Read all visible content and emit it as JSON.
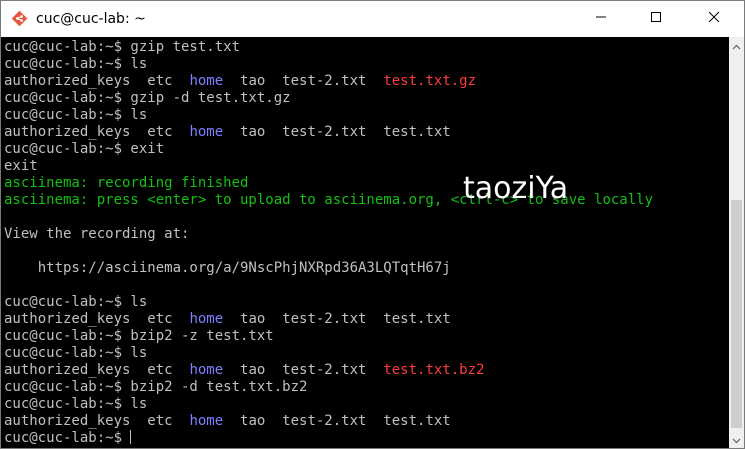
{
  "window": {
    "title": "cuc@cuc-lab: ~"
  },
  "icons": {
    "app": "git-diamond-icon",
    "minimize": "minimize-icon",
    "maximize": "maximize-icon",
    "close": "close-icon",
    "scroll_up": "chevron-up-icon",
    "scroll_down": "chevron-down-icon"
  },
  "colors": {
    "background": "#000000",
    "text": "#c0c0c0",
    "directory": "#7f7fff",
    "archive": "#ff3b3b",
    "asciinema": "#13c013",
    "watermark": "#ffffff"
  },
  "terminal": {
    "lines": [
      [
        {
          "text": "cuc@cuc-lab:~$ gzip test.txt",
          "color": "default"
        }
      ],
      [
        {
          "text": "cuc@cuc-lab:~$ ls",
          "color": "default"
        }
      ],
      [
        {
          "text": "authorized_keys  etc  ",
          "color": "default"
        },
        {
          "text": "home",
          "color": "blue"
        },
        {
          "text": "  tao  test-2.txt  ",
          "color": "default"
        },
        {
          "text": "test.txt.gz",
          "color": "red"
        }
      ],
      [
        {
          "text": "cuc@cuc-lab:~$ gzip -d test.txt.gz",
          "color": "default"
        }
      ],
      [
        {
          "text": "cuc@cuc-lab:~$ ls",
          "color": "default"
        }
      ],
      [
        {
          "text": "authorized_keys  etc  ",
          "color": "default"
        },
        {
          "text": "home",
          "color": "blue"
        },
        {
          "text": "  tao  test-2.txt  test.txt",
          "color": "default"
        }
      ],
      [
        {
          "text": "cuc@cuc-lab:~$ exit",
          "color": "default"
        }
      ],
      [
        {
          "text": "exit",
          "color": "default"
        }
      ],
      [
        {
          "text": "asciinema: recording finished",
          "color": "green"
        }
      ],
      [
        {
          "text": "asciinema: press <enter> to upload to asciinema.org, <ctrl-c> to save locally",
          "color": "green"
        }
      ],
      [],
      [
        {
          "text": "View the recording at:",
          "color": "default"
        }
      ],
      [],
      [
        {
          "text": "    https://asciinema.org/a/9NscPhjNXRpd36A3LQTqtH67j",
          "color": "default"
        }
      ],
      [],
      [
        {
          "text": "cuc@cuc-lab:~$ ls",
          "color": "default"
        }
      ],
      [
        {
          "text": "authorized_keys  etc  ",
          "color": "default"
        },
        {
          "text": "home",
          "color": "blue"
        },
        {
          "text": "  tao  test-2.txt  test.txt",
          "color": "default"
        }
      ],
      [
        {
          "text": "cuc@cuc-lab:~$ bzip2 -z test.txt",
          "color": "default"
        }
      ],
      [
        {
          "text": "cuc@cuc-lab:~$ ls",
          "color": "default"
        }
      ],
      [
        {
          "text": "authorized_keys  etc  ",
          "color": "default"
        },
        {
          "text": "home",
          "color": "blue"
        },
        {
          "text": "  tao  test-2.txt  ",
          "color": "default"
        },
        {
          "text": "test.txt.bz2",
          "color": "red"
        }
      ],
      [
        {
          "text": "cuc@cuc-lab:~$ bzip2 -d test.txt.bz2",
          "color": "default"
        }
      ],
      [
        {
          "text": "cuc@cuc-lab:~$ ls",
          "color": "default"
        }
      ],
      [
        {
          "text": "authorized_keys  etc  ",
          "color": "default"
        },
        {
          "text": "home",
          "color": "blue"
        },
        {
          "text": "  tao  test-2.txt  test.txt",
          "color": "default"
        }
      ],
      [
        {
          "text": "cuc@cuc-lab:~$ ",
          "color": "default"
        }
      ]
    ]
  },
  "watermark": {
    "text": "taoziYa"
  }
}
